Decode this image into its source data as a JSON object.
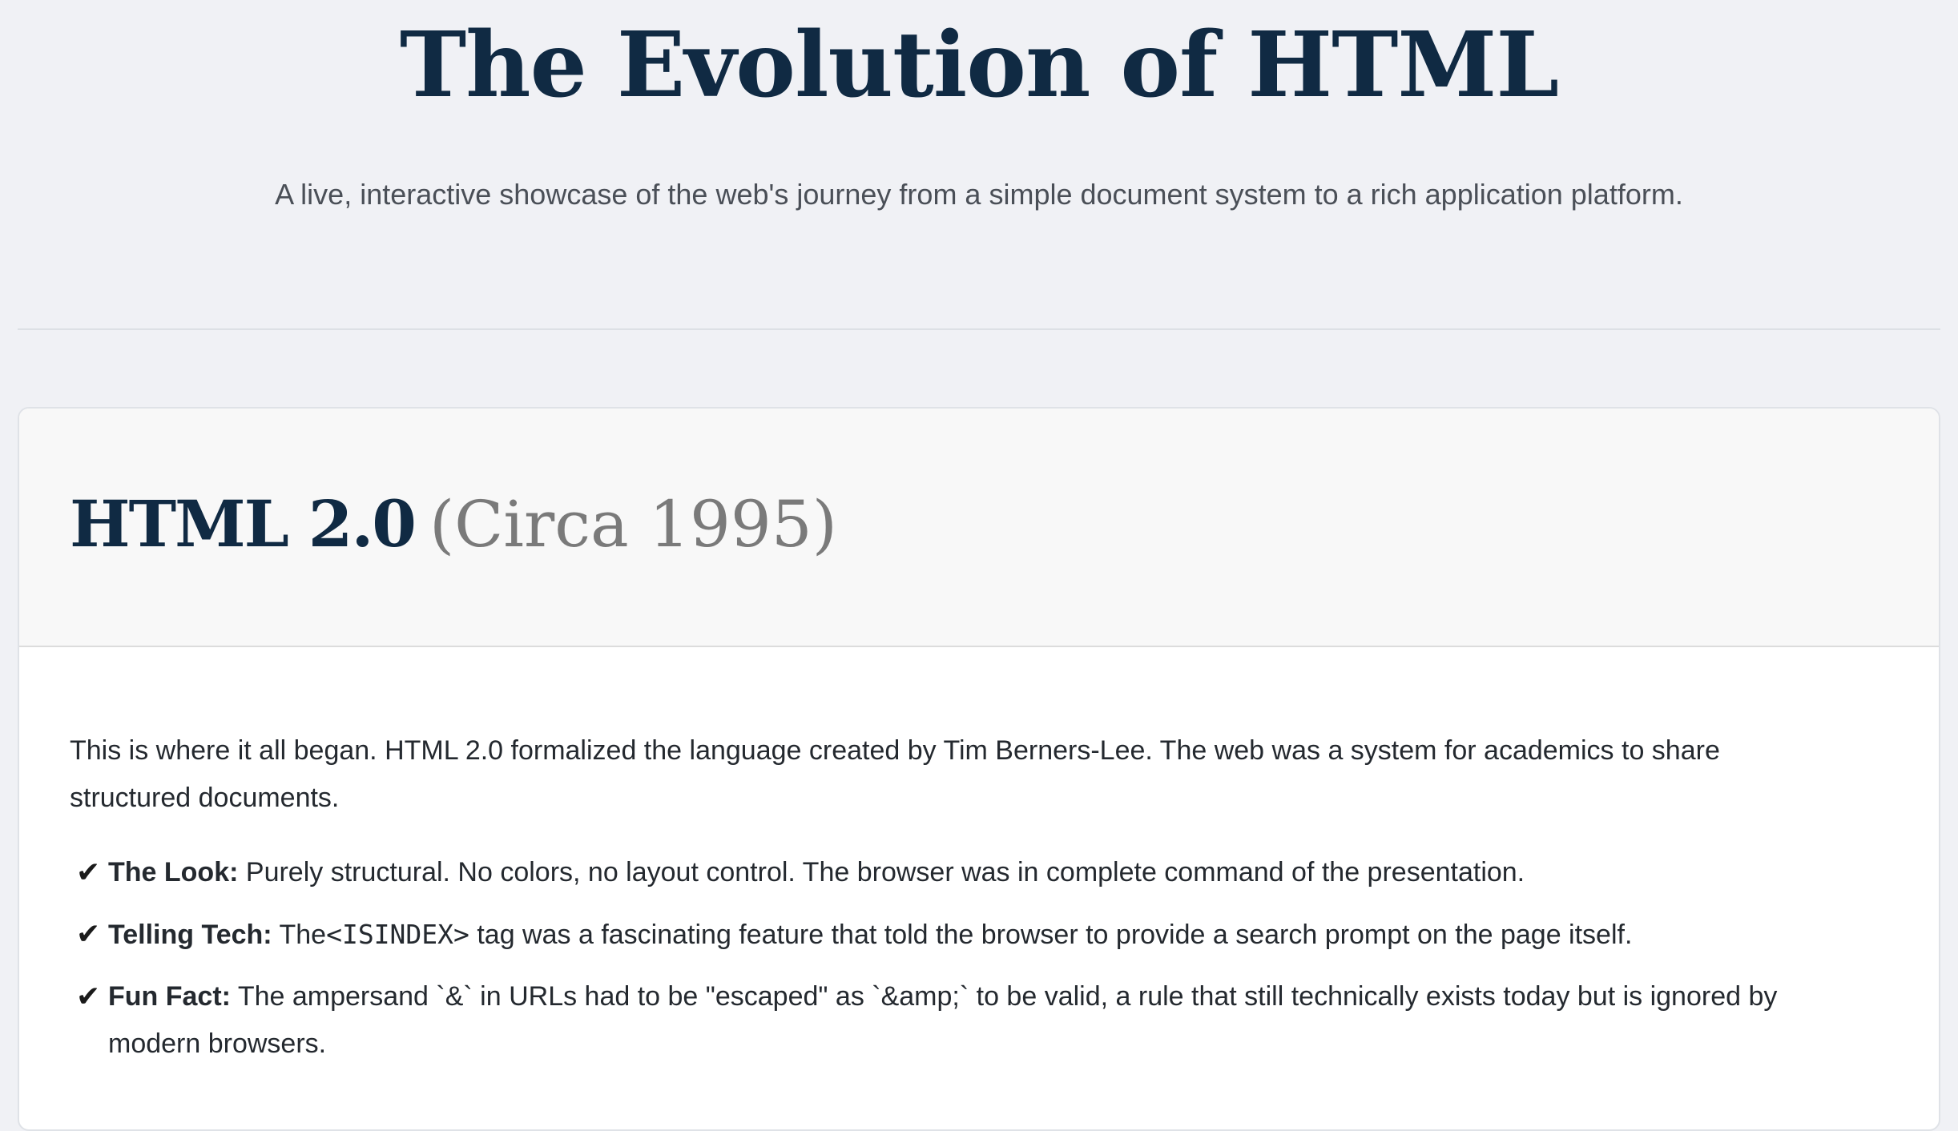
{
  "header": {
    "title": "The Evolution of HTML",
    "subtitle": "A live, interactive showcase of the web's journey from a simple document system to a rich application platform."
  },
  "card": {
    "version": "HTML 2.0",
    "era": "(Circa 1995)",
    "intro": "This is where it all began. HTML 2.0 formalized the language created by Tim Berners-Lee. The web was a system for academics to share structured documents.",
    "facts": [
      {
        "icon": "check-icon",
        "check": "✔",
        "label": "The Look:",
        "text": "Purely structural. No colors, no layout control. The browser was in complete command of the presentation."
      },
      {
        "icon": "check-icon",
        "check": "✔",
        "label": "Telling Tech:",
        "text_before": "The",
        "code": "<ISINDEX>",
        "text_after": "tag was a fascinating feature that told the browser to provide a search prompt on the page itself."
      },
      {
        "icon": "check-icon",
        "check": "✔",
        "label": "Fun Fact:",
        "text": "The ampersand `&` in URLs had to be \"escaped\" as `&amp;` to be valid, a rule that still technically exists today but is ignored by modern browsers."
      }
    ]
  }
}
